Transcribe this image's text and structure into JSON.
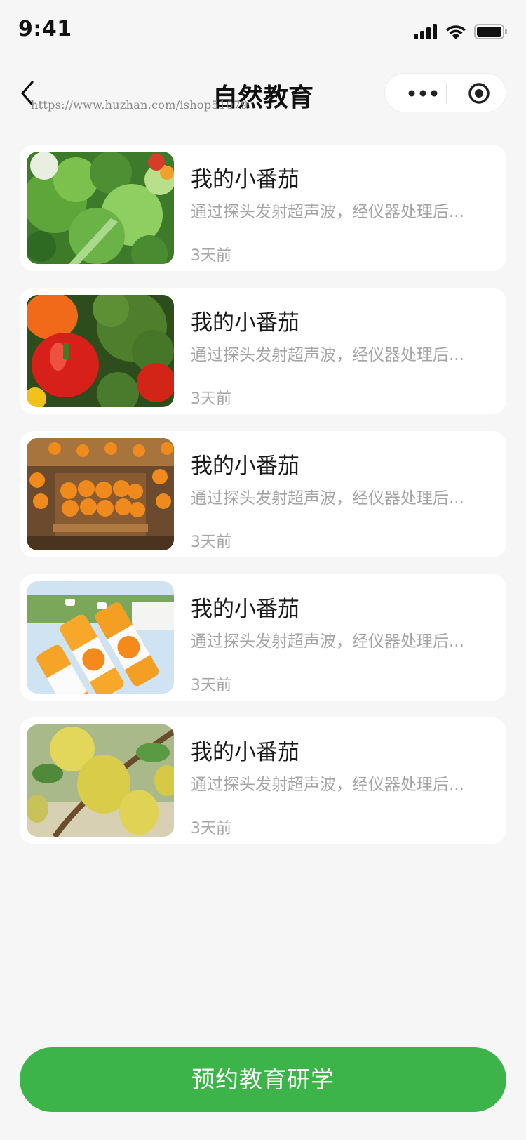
{
  "status_bar": {
    "time": "9:41"
  },
  "nav": {
    "title": "自然教育",
    "watermark": "https://www.huzhan.com/ishop51079"
  },
  "items": [
    {
      "title": "我的小番茄",
      "desc": "通过探头发射超声波，经仪器处理后...",
      "time": "3天前",
      "image": "leafy-vegetables"
    },
    {
      "title": "我的小番茄",
      "desc": "通过探头发射超声波，经仪器处理后...",
      "time": "3天前",
      "image": "peppers-broccoli"
    },
    {
      "title": "我的小番茄",
      "desc": "通过探头发射超声波，经仪器处理后...",
      "time": "3天前",
      "image": "oranges-in-crates"
    },
    {
      "title": "我的小番茄",
      "desc": "通过探头发射超声波，经仪器处理后...",
      "time": "3天前",
      "image": "orange-juice-bottles"
    },
    {
      "title": "我的小番茄",
      "desc": "通过探头发射超声波，经仪器处理后...",
      "time": "3天前",
      "image": "pears-on-branch"
    }
  ],
  "book_button": {
    "label": "预约教育研学"
  },
  "colors": {
    "accent": "#3cb44a",
    "background": "#f6f6f6"
  }
}
